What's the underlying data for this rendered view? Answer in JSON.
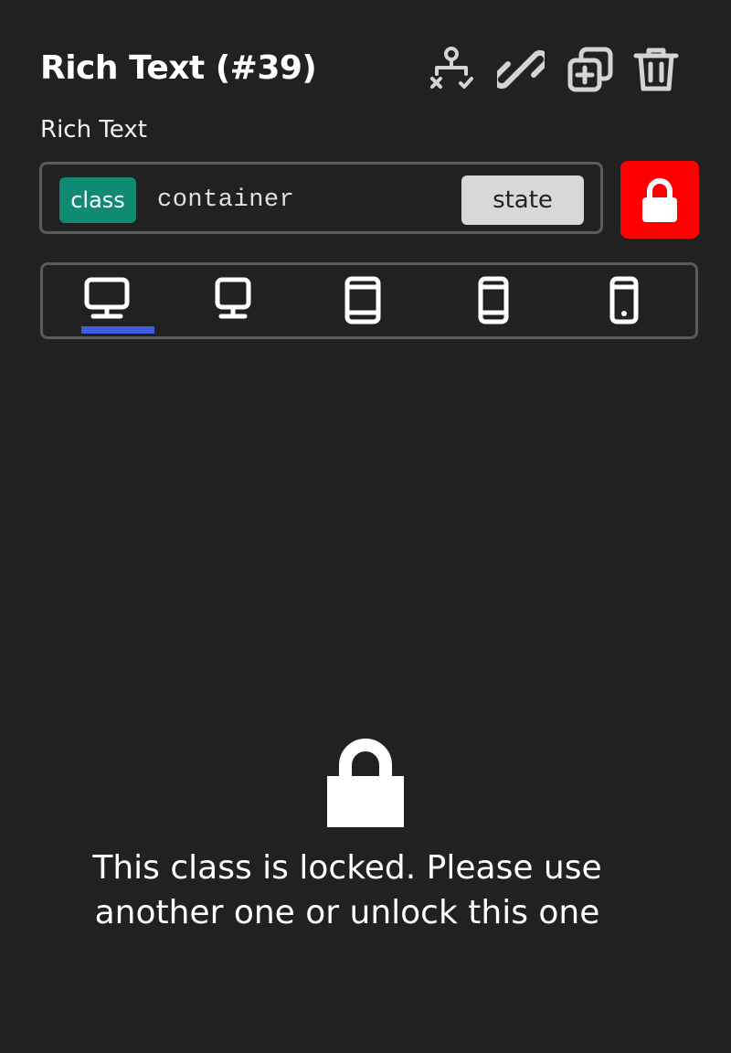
{
  "header": {
    "title": "Rich Text (#39)",
    "subtitle": "Rich Text",
    "actions": [
      "tree-structure-icon",
      "link-icon",
      "duplicate-icon",
      "trash-icon"
    ]
  },
  "selector": {
    "badge": "class",
    "class_value": "container",
    "state_label": "state",
    "lock_color": "#ff0000",
    "badge_color": "#108a72"
  },
  "devices": {
    "items": [
      "desktop-icon",
      "laptop-icon",
      "tablet-landscape-icon",
      "tablet-portrait-icon",
      "mobile-icon"
    ],
    "active": "desktop-icon",
    "active_color": "#3d5de0"
  },
  "locked": {
    "message": "This class is locked. Please use another one or unlock this one"
  }
}
